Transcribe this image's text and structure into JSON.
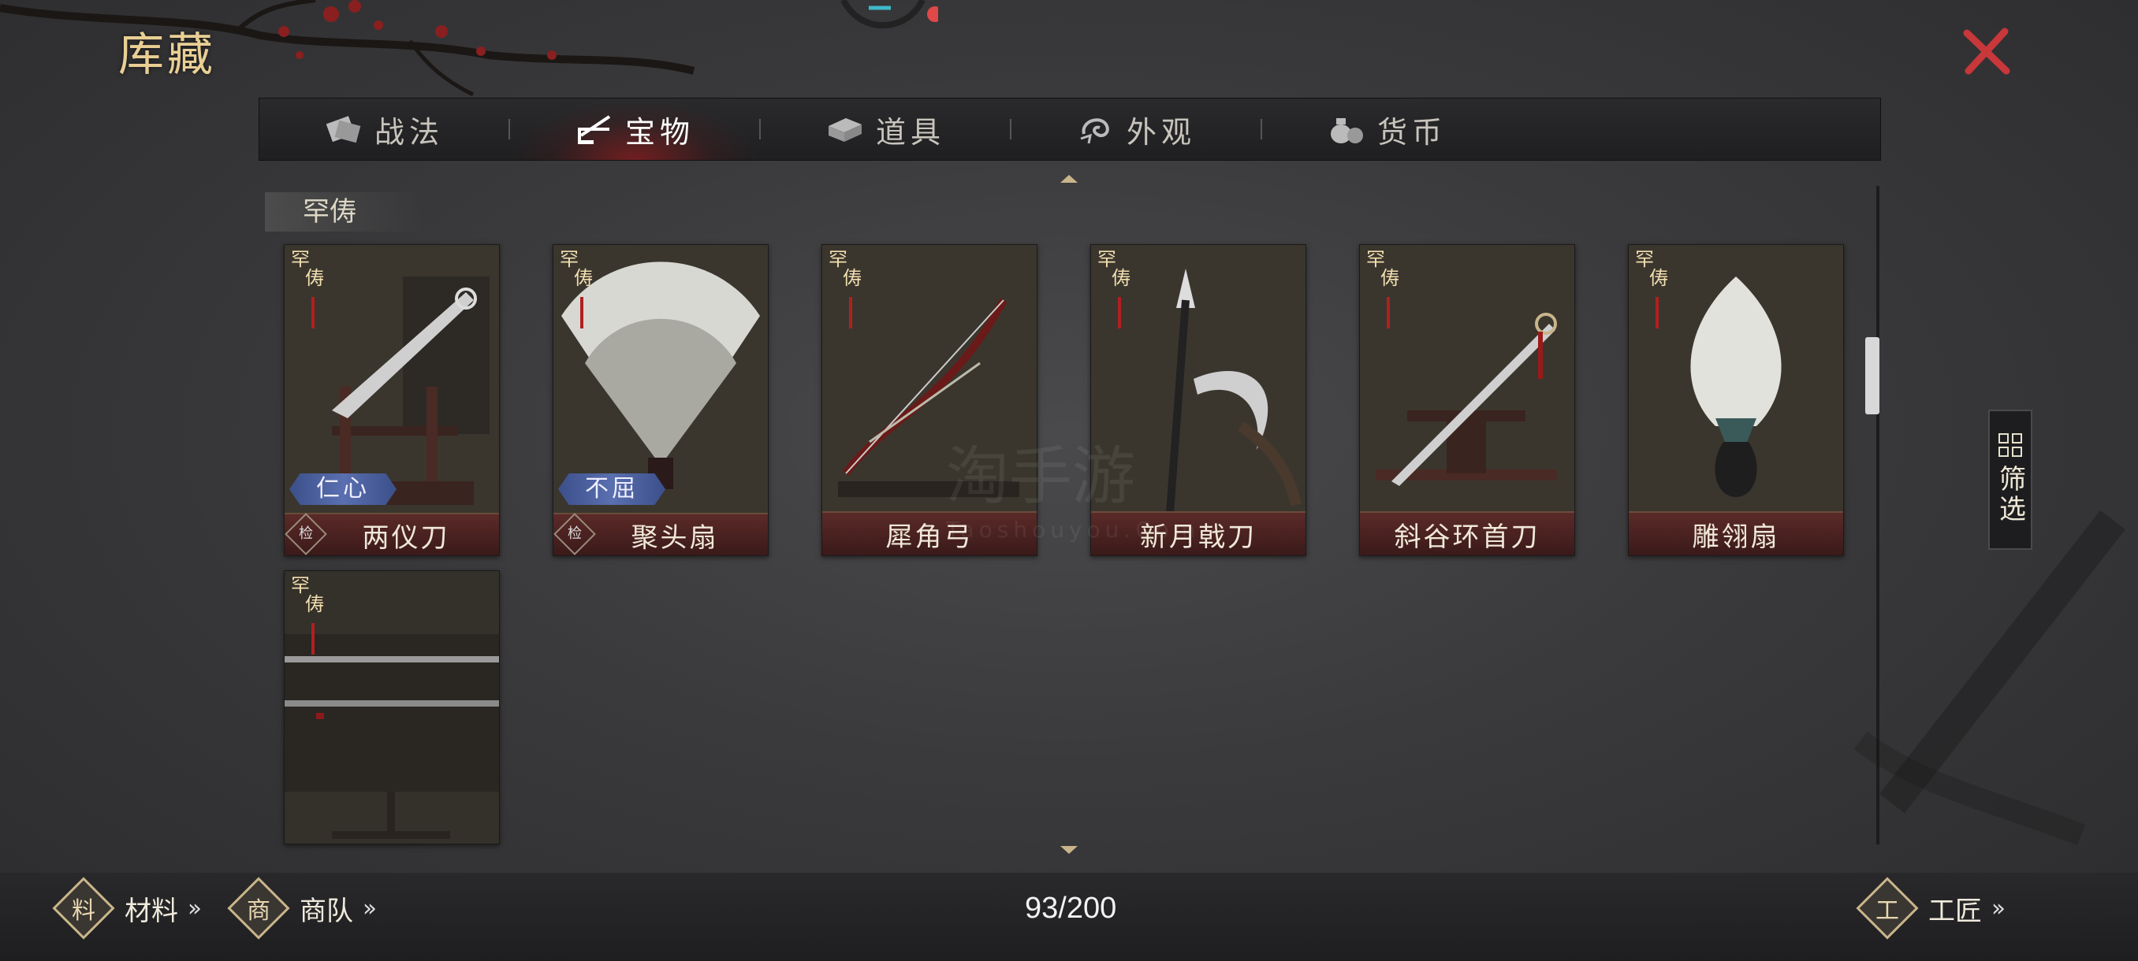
{
  "title": "库藏",
  "tabs": [
    {
      "label": "战法",
      "icon": "scroll-bundle-icon",
      "active": false
    },
    {
      "label": "宝物",
      "icon": "weapon-rack-icon",
      "active": true
    },
    {
      "label": "道具",
      "icon": "chest-icon",
      "active": false
    },
    {
      "label": "外观",
      "icon": "swirl-icon",
      "active": false
    },
    {
      "label": "货币",
      "icon": "money-bag-icon",
      "active": false
    }
  ],
  "section": {
    "label": "罕俦"
  },
  "rarity_tag": {
    "line1": "罕",
    "line2": "俦"
  },
  "items": [
    {
      "name": "两仪刀",
      "trait": "仁心",
      "seal": "检"
    },
    {
      "name": "聚头扇",
      "trait": "不屈",
      "seal": "检"
    },
    {
      "name": "犀角弓"
    },
    {
      "name": "新月戟刀"
    },
    {
      "name": "斜谷环首刀"
    },
    {
      "name": "雕翎扇"
    },
    {
      "name": ""
    }
  ],
  "filter": {
    "label": "筛选"
  },
  "watermark": {
    "main": "淘手游",
    "sub": "Taoshouyou.Com"
  },
  "bottom": {
    "materials": {
      "label": "材料",
      "glyph": "料"
    },
    "caravan": {
      "label": "商队",
      "glyph": "商"
    },
    "craftsman": {
      "label": "工匠",
      "glyph": "工"
    },
    "capacity": "93/200"
  },
  "colors": {
    "accent_gold": "#e9cf94",
    "close_red": "#c8373a",
    "active_tab_glow": "#b41e1e"
  }
}
